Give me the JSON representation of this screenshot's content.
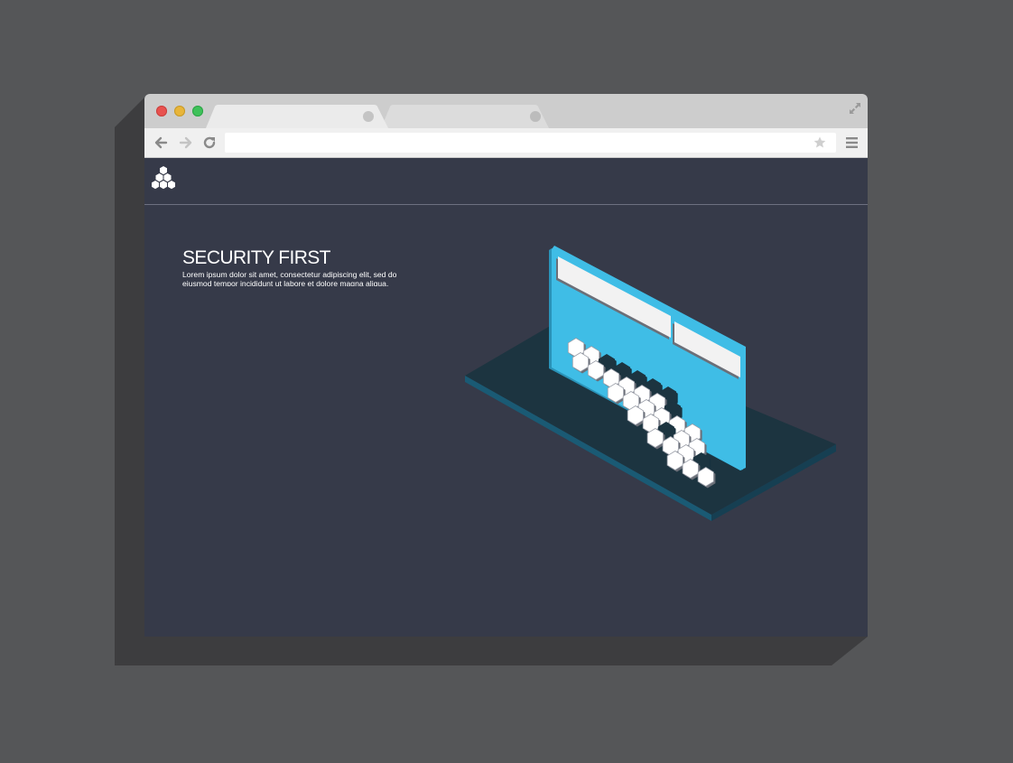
{
  "browser": {
    "window_controls": [
      "close",
      "minimize",
      "zoom"
    ],
    "tabs": [
      {
        "label": "",
        "active": true
      },
      {
        "label": "",
        "active": false
      }
    ],
    "address_bar": {
      "value": "",
      "placeholder": ""
    },
    "icons": {
      "back": "back-arrow-icon",
      "forward": "forward-arrow-icon",
      "reload": "reload-icon",
      "bookmark": "star-icon",
      "menu": "hamburger-menu-icon",
      "fullscreen": "expand-icon"
    }
  },
  "site": {
    "logo": "hexagon-cluster-logo",
    "hero": {
      "title": "SECURITY FIRST",
      "text": "Lorem ipsum dolor sit amet, consectetur adipiscing elit, sed do eiusmod tempor incididunt ut labore et dolore magna aliqua."
    },
    "illustration": "isometric-login-card-with-hexagons"
  },
  "colors": {
    "background": "#555658",
    "page_background": "#363a49",
    "accent": "#3fbde6",
    "platform": "#1c3440",
    "platform_edge": "#1a5a74",
    "tab_bar": "#cdcdcd",
    "toolbar": "#f0f0f0"
  }
}
